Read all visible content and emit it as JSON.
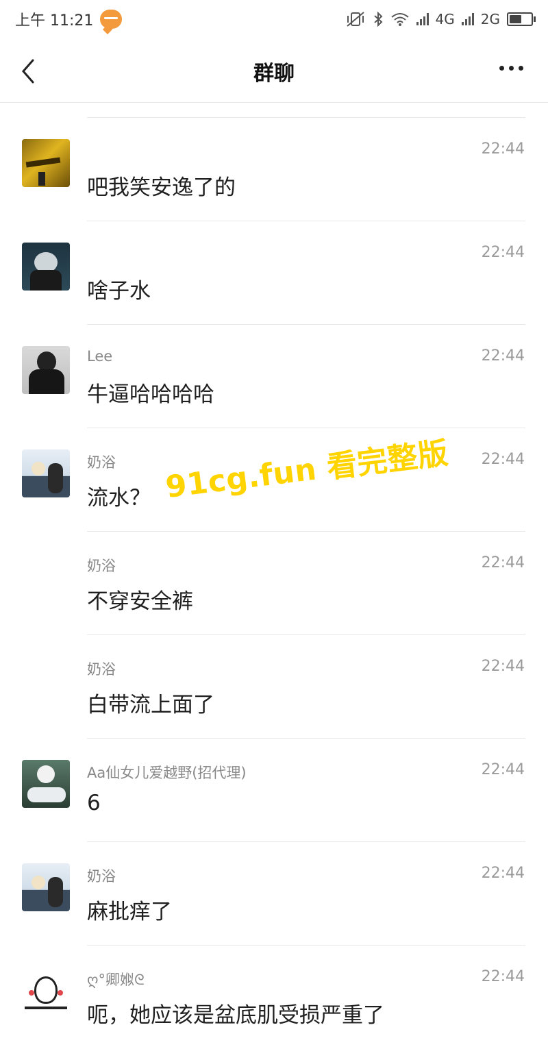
{
  "status_bar": {
    "time": "上午 11:21",
    "network_1": "4G",
    "network_2": "2G",
    "battery_level": 0.55
  },
  "header": {
    "title": "群聊"
  },
  "messages": [
    {
      "sender": "",
      "time": "22:44",
      "text": "吧我笑安逸了的",
      "avatar": "avatar-yellow-sign"
    },
    {
      "sender": "",
      "time": "22:44",
      "text": "啥子水",
      "avatar": "avatar-dark-figure"
    },
    {
      "sender": "Lee",
      "time": "22:44",
      "text": "牛逼哈哈哈哈",
      "avatar": "avatar-person"
    },
    {
      "sender": "奶浴",
      "time": "22:44",
      "text": "流水？",
      "avatar": "avatar-couple"
    },
    {
      "sender": "奶浴",
      "time": "22:44",
      "text": "不穿安全裤",
      "avatar": ""
    },
    {
      "sender": "奶浴",
      "time": "22:44",
      "text": "白带流上面了",
      "avatar": ""
    },
    {
      "sender": "Aa仙女儿爱越野(招代理)",
      "time": "22:44",
      "text": "6",
      "avatar": "avatar-rider"
    },
    {
      "sender": "奶浴",
      "time": "22:44",
      "text": "麻批痒了",
      "avatar": "avatar-couple"
    },
    {
      "sender": "ღ°卿娰ᘓ",
      "time": "22:44",
      "text": "呃，她应该是盆底肌受损严重了",
      "avatar": "avatar-cartoon"
    }
  ],
  "watermark": "91cg.fun 看完整版",
  "colors": {
    "watermark": "#ffd400",
    "timestamp": "#9a9a9a",
    "sender": "#888888",
    "notification": "#f39a3c"
  }
}
